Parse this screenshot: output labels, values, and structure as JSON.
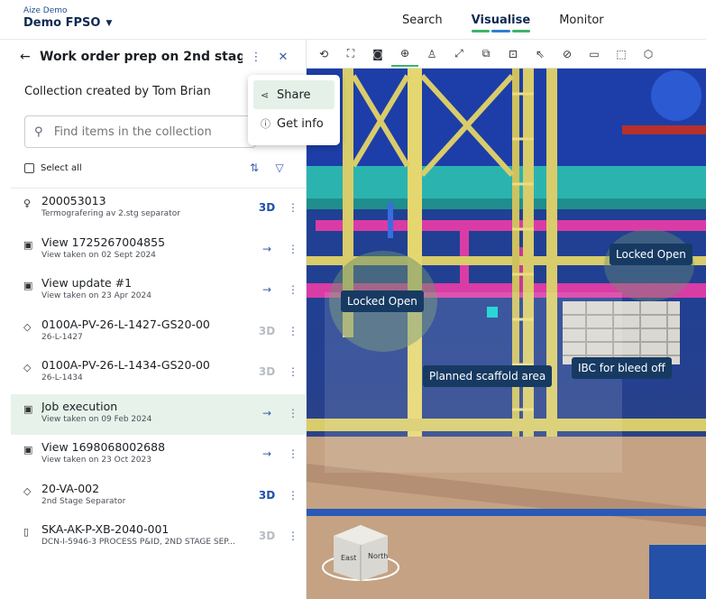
{
  "app": {
    "org": "Aize Demo",
    "project": "Demo FPSO"
  },
  "topnav": {
    "items": [
      "Search",
      "Visualise",
      "Monitor"
    ],
    "active_index": 1
  },
  "panel": {
    "title": "Work order prep on 2nd stag...",
    "creator": "Collection created by Tom Brian",
    "search_placeholder": "Find items in the collection",
    "select_all": "Select all"
  },
  "menu": {
    "share": "Share",
    "get_info": "Get info"
  },
  "items": [
    {
      "icon": "pin-icon",
      "title": "200053013",
      "sub": "Termografering av 2.stg separator",
      "action": "3D",
      "action_kind": "3d-active"
    },
    {
      "icon": "image-icon",
      "title": "View 1725267004855",
      "sub": "View taken on 02 Sept 2024",
      "action": "→",
      "action_kind": "arrow"
    },
    {
      "icon": "image-icon",
      "title": "View update #1",
      "sub": "View taken on 23 Apr 2024",
      "action": "→",
      "action_kind": "arrow"
    },
    {
      "icon": "tag-icon",
      "title": "0100A-PV-26-L-1427-GS20-00",
      "sub": "26-L-1427",
      "action": "3D",
      "action_kind": "3d-disabled"
    },
    {
      "icon": "tag-icon",
      "title": "0100A-PV-26-L-1434-GS20-00",
      "sub": "26-L-1434",
      "action": "3D",
      "action_kind": "3d-disabled"
    },
    {
      "icon": "image-icon",
      "title": "Job execution",
      "sub": "View taken on 09 Feb 2024",
      "action": "→",
      "action_kind": "arrow",
      "highlight": true
    },
    {
      "icon": "image-icon",
      "title": "View 1698068002688",
      "sub": "View taken on 23 Oct 2023",
      "action": "→",
      "action_kind": "arrow"
    },
    {
      "icon": "tag-icon",
      "title": "20-VA-002",
      "sub": "2nd Stage Separator",
      "action": "3D",
      "action_kind": "3d-active"
    },
    {
      "icon": "document-icon",
      "title": "SKA-AK-P-XB-2040-001",
      "sub": "DCN-I-5946-3 PROCESS P&ID, 2ND STAGE SEP...",
      "action": "3D",
      "action_kind": "3d-disabled"
    }
  ],
  "scene_labels": {
    "locked_open_left": "Locked Open",
    "locked_open_right": "Locked Open",
    "scaffold": "Planned scaffold area",
    "ibc": "IBC for bleed off"
  },
  "nav_cube": {
    "face1": "East",
    "face2": "North"
  },
  "colors": {
    "accent_green": "#3fb26a",
    "brand_navy": "#0f2a52",
    "label_bg": "#173a63"
  }
}
